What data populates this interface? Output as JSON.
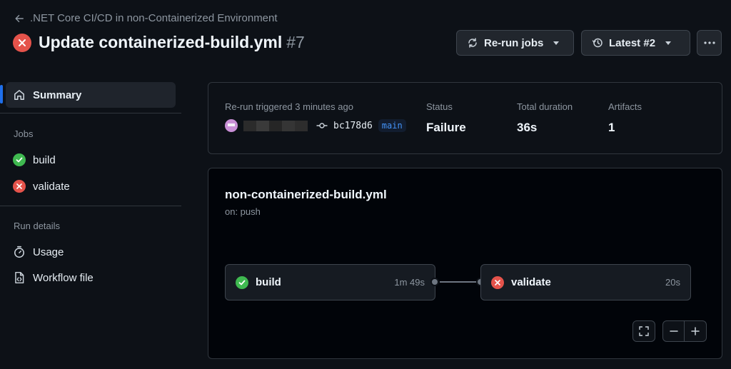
{
  "header": {
    "breadcrumb": ".NET Core CI/CD in non-Containerized Environment",
    "title": "Update containerized-build.yml",
    "run_number": "#7",
    "rerun_label": "Re-run jobs",
    "attempt_label": "Latest #2"
  },
  "sidebar": {
    "summary_label": "Summary",
    "jobs_heading": "Jobs",
    "jobs": [
      {
        "label": "build",
        "status": "success"
      },
      {
        "label": "validate",
        "status": "failure"
      }
    ],
    "run_details_heading": "Run details",
    "details": [
      {
        "label": "Usage",
        "icon": "stopwatch-icon"
      },
      {
        "label": "Workflow file",
        "icon": "file-code-icon"
      }
    ]
  },
  "summary": {
    "trigger_text": "Re-run triggered 3 minutes ago",
    "commit": "bc178d6",
    "branch": "main",
    "status_label": "Status",
    "status_value": "Failure",
    "duration_label": "Total duration",
    "duration_value": "36s",
    "artifacts_label": "Artifacts",
    "artifacts_value": "1"
  },
  "workflow": {
    "file": "non-containerized-build.yml",
    "trigger": "on: push",
    "jobs": [
      {
        "name": "build",
        "duration": "1m 49s",
        "status": "success"
      },
      {
        "name": "validate",
        "duration": "20s",
        "status": "failure"
      }
    ]
  },
  "colors": {
    "success": "#3fb950",
    "failure": "#e5534b",
    "accent": "#1f6feb"
  }
}
